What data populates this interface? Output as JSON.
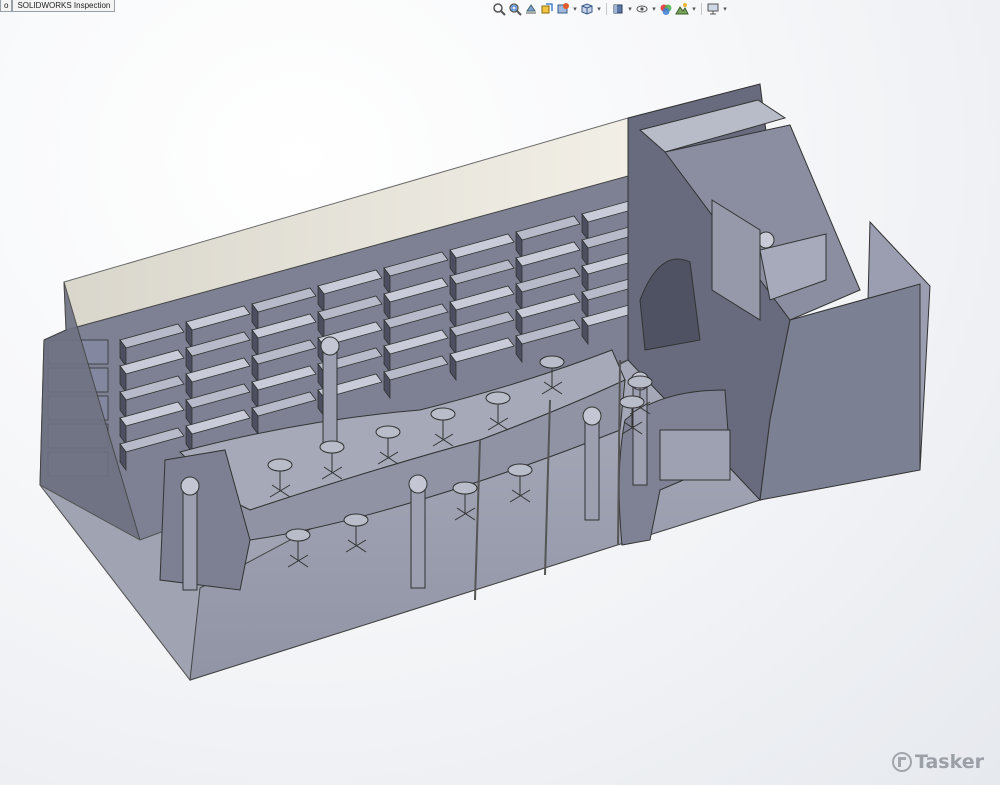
{
  "tabs": [
    {
      "label": "o"
    },
    {
      "label": "SOLIDWORKS Inspection"
    }
  ],
  "heads_up_toolbar": [
    {
      "icon": "zoom-to-fit-icon"
    },
    {
      "icon": "zoom-to-area-icon"
    },
    {
      "icon": "previous-view-icon"
    },
    {
      "icon": "section-view-icon"
    },
    {
      "icon": "dynamic-annotation-icon"
    },
    {
      "icon": "view-orientation-icon"
    },
    {
      "icon": "display-style-icon"
    },
    {
      "icon": "hide-show-items-icon"
    },
    {
      "icon": "edit-appearance-icon"
    },
    {
      "icon": "apply-scene-icon"
    },
    {
      "icon": "view-settings-icon"
    }
  ],
  "colors": {
    "model_face": "#8e93a6",
    "model_dark": "#5b6070",
    "model_light": "#c3c6d2",
    "background_center": "#ffffff",
    "background_edge": "#e6e9ee"
  },
  "watermark": {
    "text": "Tasker",
    "icon": "tasker-logo-icon"
  }
}
